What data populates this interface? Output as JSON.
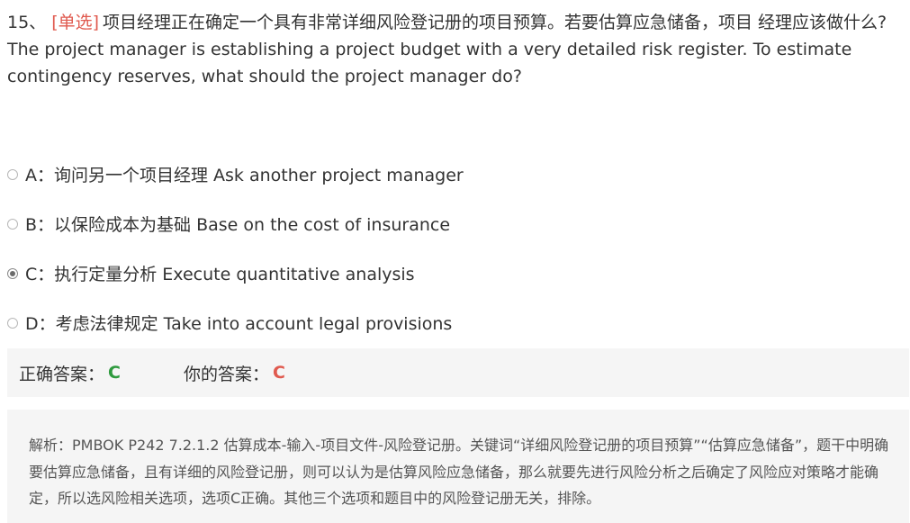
{
  "question": {
    "number": "15、",
    "type": "[单选]",
    "text_cn": "项目经理正在确定一个具有非常详细风险登记册的项目预算。若要估算应急储备，项目 经理应该做什么?",
    "text_en": "The project manager is establishing a project budget with a very detailed risk register. To estimate contingency reserves, what should the project manager do?"
  },
  "options": [
    {
      "label": "A：询问另一个项目经理 Ask another project manager",
      "selected": false
    },
    {
      "label": "B：以保险成本为基础 Base on the cost of insurance",
      "selected": false
    },
    {
      "label": "C：执行定量分析 Execute quantitative analysis",
      "selected": true
    },
    {
      "label": "D：考虑法律规定 Take into account legal provisions",
      "selected": false
    }
  ],
  "answer": {
    "correct_label": "正确答案：",
    "correct_value": "C",
    "mine_label": "你的答案：",
    "mine_value": "C"
  },
  "analysis": {
    "text": "解析：PMBOK P242 7.2.1.2 估算成本-输入-项目文件-风险登记册。关键词“详细风险登记册的项目预算”“估算应急储备”，题干中明确要估算应急储备，且有详细的风险登记册，则可以认为是估算风险应急储备，那么就要先进行风险分析之后确定了风险应对策略才能确定，所以选风险相关选项，选项C正确。其他三个选项和题目中的风险登记册无关，排除。"
  },
  "colors": {
    "type_tag": "#e05a4f",
    "correct": "#2e9a3e",
    "mine": "#e05a4f",
    "panel_bg": "#f5f5f5"
  }
}
